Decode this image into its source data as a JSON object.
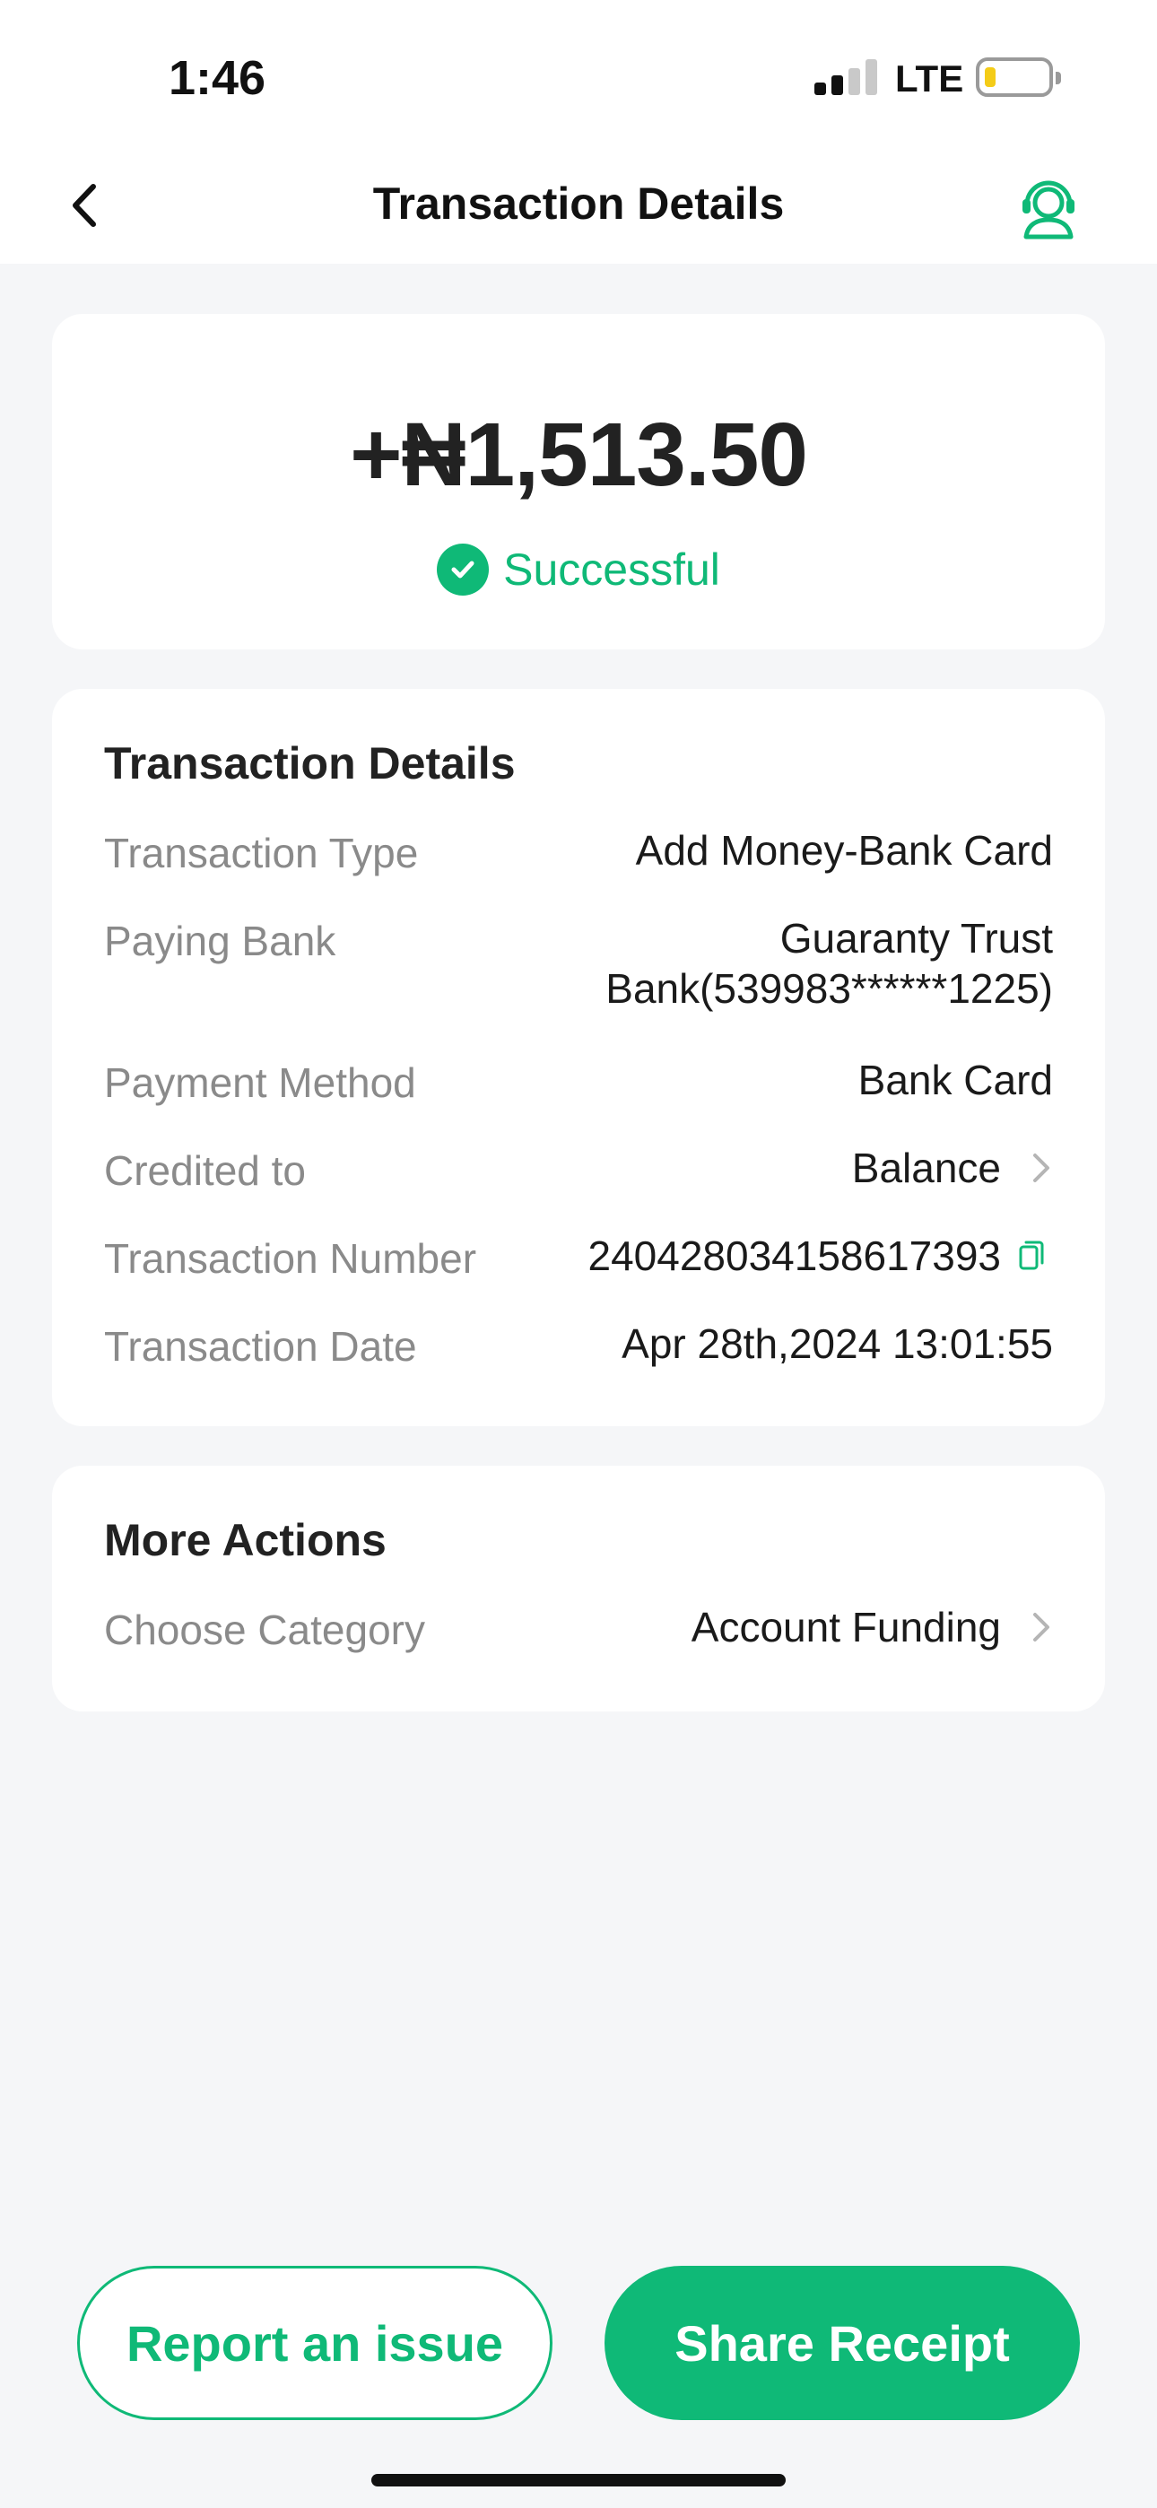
{
  "status_bar": {
    "time": "1:46",
    "network": "LTE"
  },
  "nav": {
    "title": "Transaction Details"
  },
  "summary": {
    "amount": "+₦1,513.50",
    "status": "Successful"
  },
  "details": {
    "title": "Transaction Details",
    "rows": [
      {
        "label": "Transaction Type",
        "value": "Add Money-Bank Card"
      },
      {
        "label": "Paying Bank",
        "value_line1": "Guaranty Trust",
        "value_line2": "Bank(539983******1225)"
      },
      {
        "label": "Payment Method",
        "value": "Bank Card"
      },
      {
        "label": "Credited to",
        "value": "Balance"
      },
      {
        "label": "Transaction Number",
        "value": "240428034158617393"
      },
      {
        "label": "Transaction Date",
        "value": "Apr 28th,2024 13:01:55"
      }
    ]
  },
  "more_actions": {
    "title": "More Actions",
    "category_label": "Choose Category",
    "category_value": "Account Funding"
  },
  "buttons": {
    "report": "Report an issue",
    "share": "Share Receipt"
  },
  "colors": {
    "accent": "#0fb977",
    "background": "#f5f6f8",
    "battery": "#f4cc18"
  },
  "icons": [
    "back-icon",
    "support-agent-icon",
    "check-circle-icon",
    "chevron-right-icon",
    "copy-icon",
    "signal-icon",
    "battery-icon"
  ]
}
